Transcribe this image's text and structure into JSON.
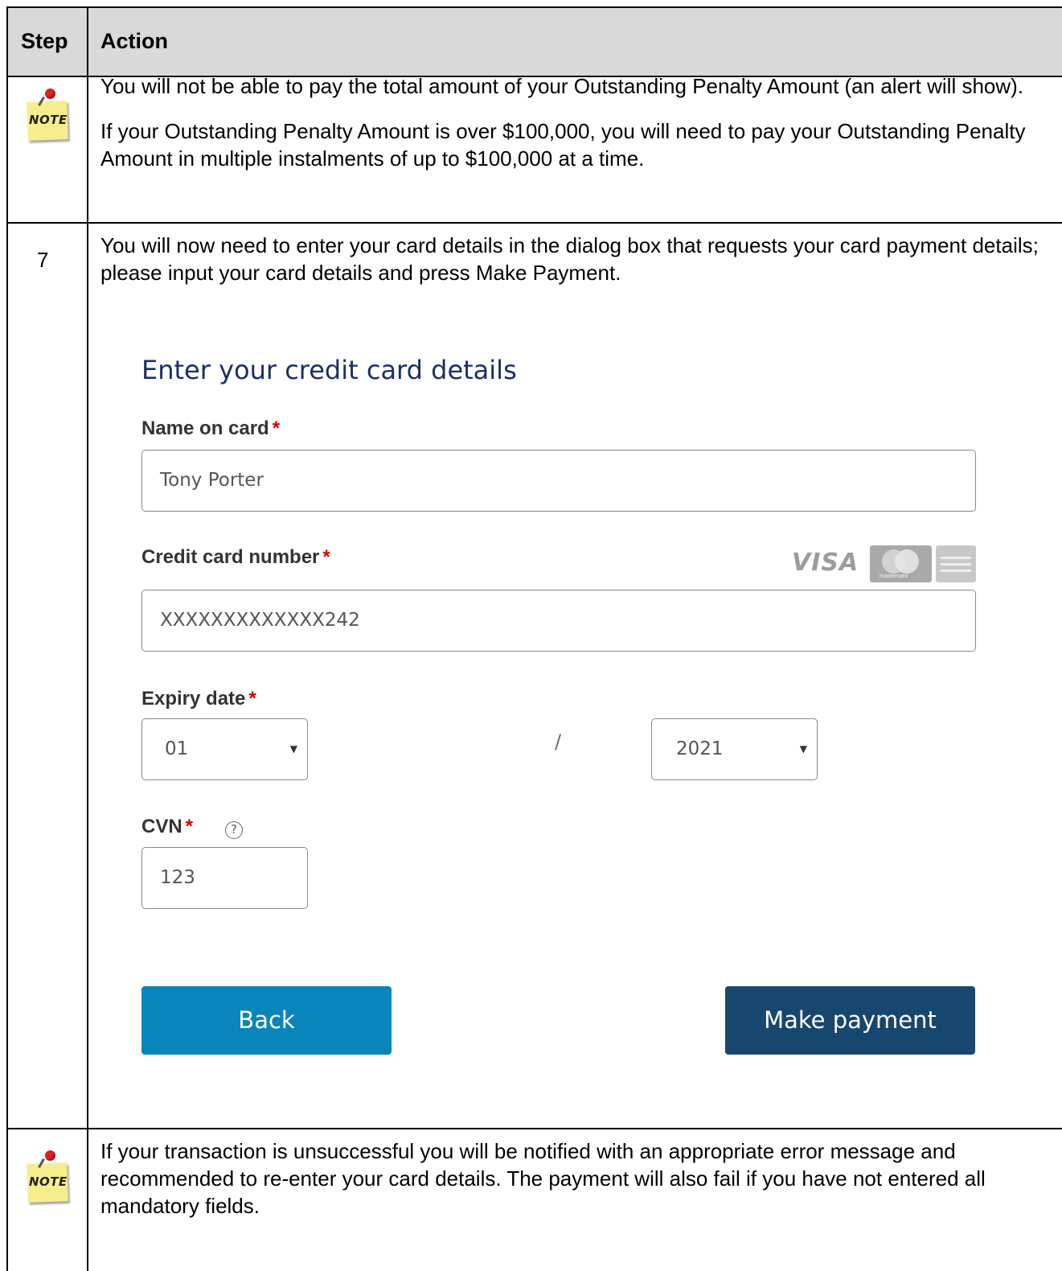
{
  "table": {
    "header_step": "Step",
    "header_action": "Action"
  },
  "note1": {
    "icon_label": "NOTE",
    "para1": "You will not be able to pay the total amount of your Outstanding Penalty Amount (an alert will show).",
    "para2": "If your Outstanding Penalty Amount is over $100,000, you will need to pay your Outstanding Penalty Amount in multiple instalments of up to $100,000 at a time."
  },
  "step7": {
    "number": "7",
    "text": "You will now need to enter your card details in the dialog box that requests your card payment details; please input your card details and press Make Payment."
  },
  "form": {
    "title": "Enter your credit card details",
    "name_label": "Name on card",
    "name_value": "Tony Porter",
    "card_label": "Credit card number",
    "card_value": "XXXXXXXXXXXXX242",
    "card_logos": [
      "VISA",
      "mastercard",
      "american-express"
    ],
    "expiry_label": "Expiry date",
    "expiry_month": "01",
    "expiry_separator": "/",
    "expiry_year": "2021",
    "cvn_label": "CVN",
    "cvn_value": "123",
    "required_marker": "*",
    "help_glyph": "?",
    "back_label": "Back",
    "pay_label": "Make payment",
    "colors": {
      "title": "#1c2e66",
      "back_button": "#0a85bb",
      "pay_button": "#17466f",
      "required": "#d40000"
    }
  },
  "note2": {
    "icon_label": "NOTE",
    "text": "If your transaction is unsuccessful you will be notified with an appropriate error message and recommended to re-enter your card details. The payment will also fail if you have not entered all mandatory fields."
  }
}
